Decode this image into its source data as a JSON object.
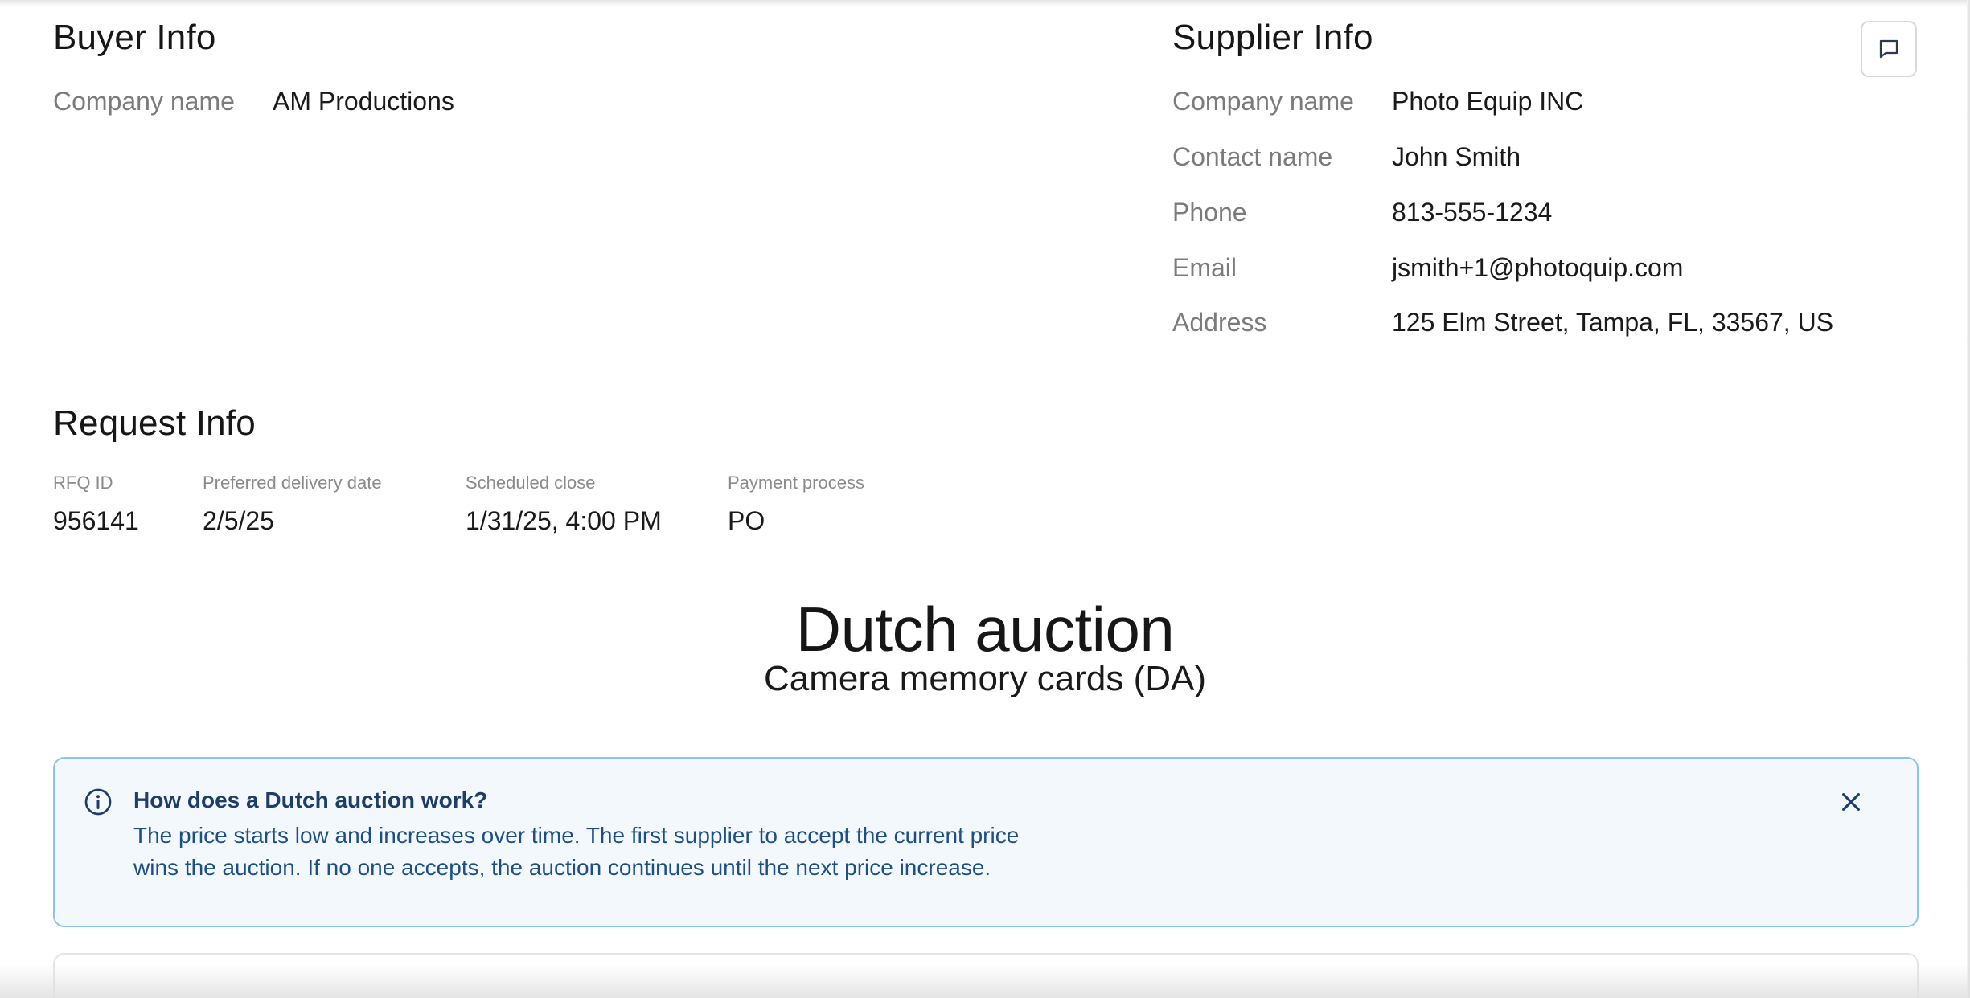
{
  "buyer": {
    "title": "Buyer Info",
    "company_label": "Company name",
    "company_value": "AM Productions"
  },
  "supplier": {
    "title": "Supplier Info",
    "fields": [
      {
        "label": "Company name",
        "value": "Photo Equip INC"
      },
      {
        "label": "Contact name",
        "value": "John Smith"
      },
      {
        "label": "Phone",
        "value": "813-555-1234"
      },
      {
        "label": "Email",
        "value": "jsmith+1@photoquip.com"
      },
      {
        "label": "Address",
        "value": "125 Elm Street, Tampa, FL, 33567, US"
      }
    ]
  },
  "request": {
    "title": "Request Info",
    "fields": [
      {
        "label": "RFQ ID",
        "value": "956141"
      },
      {
        "label": "Preferred delivery date",
        "value": "2/5/25"
      },
      {
        "label": "Scheduled close",
        "value": "1/31/25, 4:00 PM"
      },
      {
        "label": "Payment process",
        "value": "PO"
      }
    ]
  },
  "auction": {
    "title": "Dutch auction",
    "subtitle": "Camera memory cards (DA)"
  },
  "info_banner": {
    "title": "How does a Dutch auction work?",
    "line1": "The price starts low and increases over time. The first supplier to accept the current price",
    "line2": "wins the auction. If no one accepts, the auction continues until the next price increase."
  },
  "icons": {
    "comment": "comment-icon",
    "info": "info-icon",
    "close": "close-icon"
  },
  "colors": {
    "banner_border": "#8ec5e6",
    "banner_bg": "#f2f8fc",
    "banner_title": "#1d3d6b",
    "banner_text": "#1d4f86"
  }
}
